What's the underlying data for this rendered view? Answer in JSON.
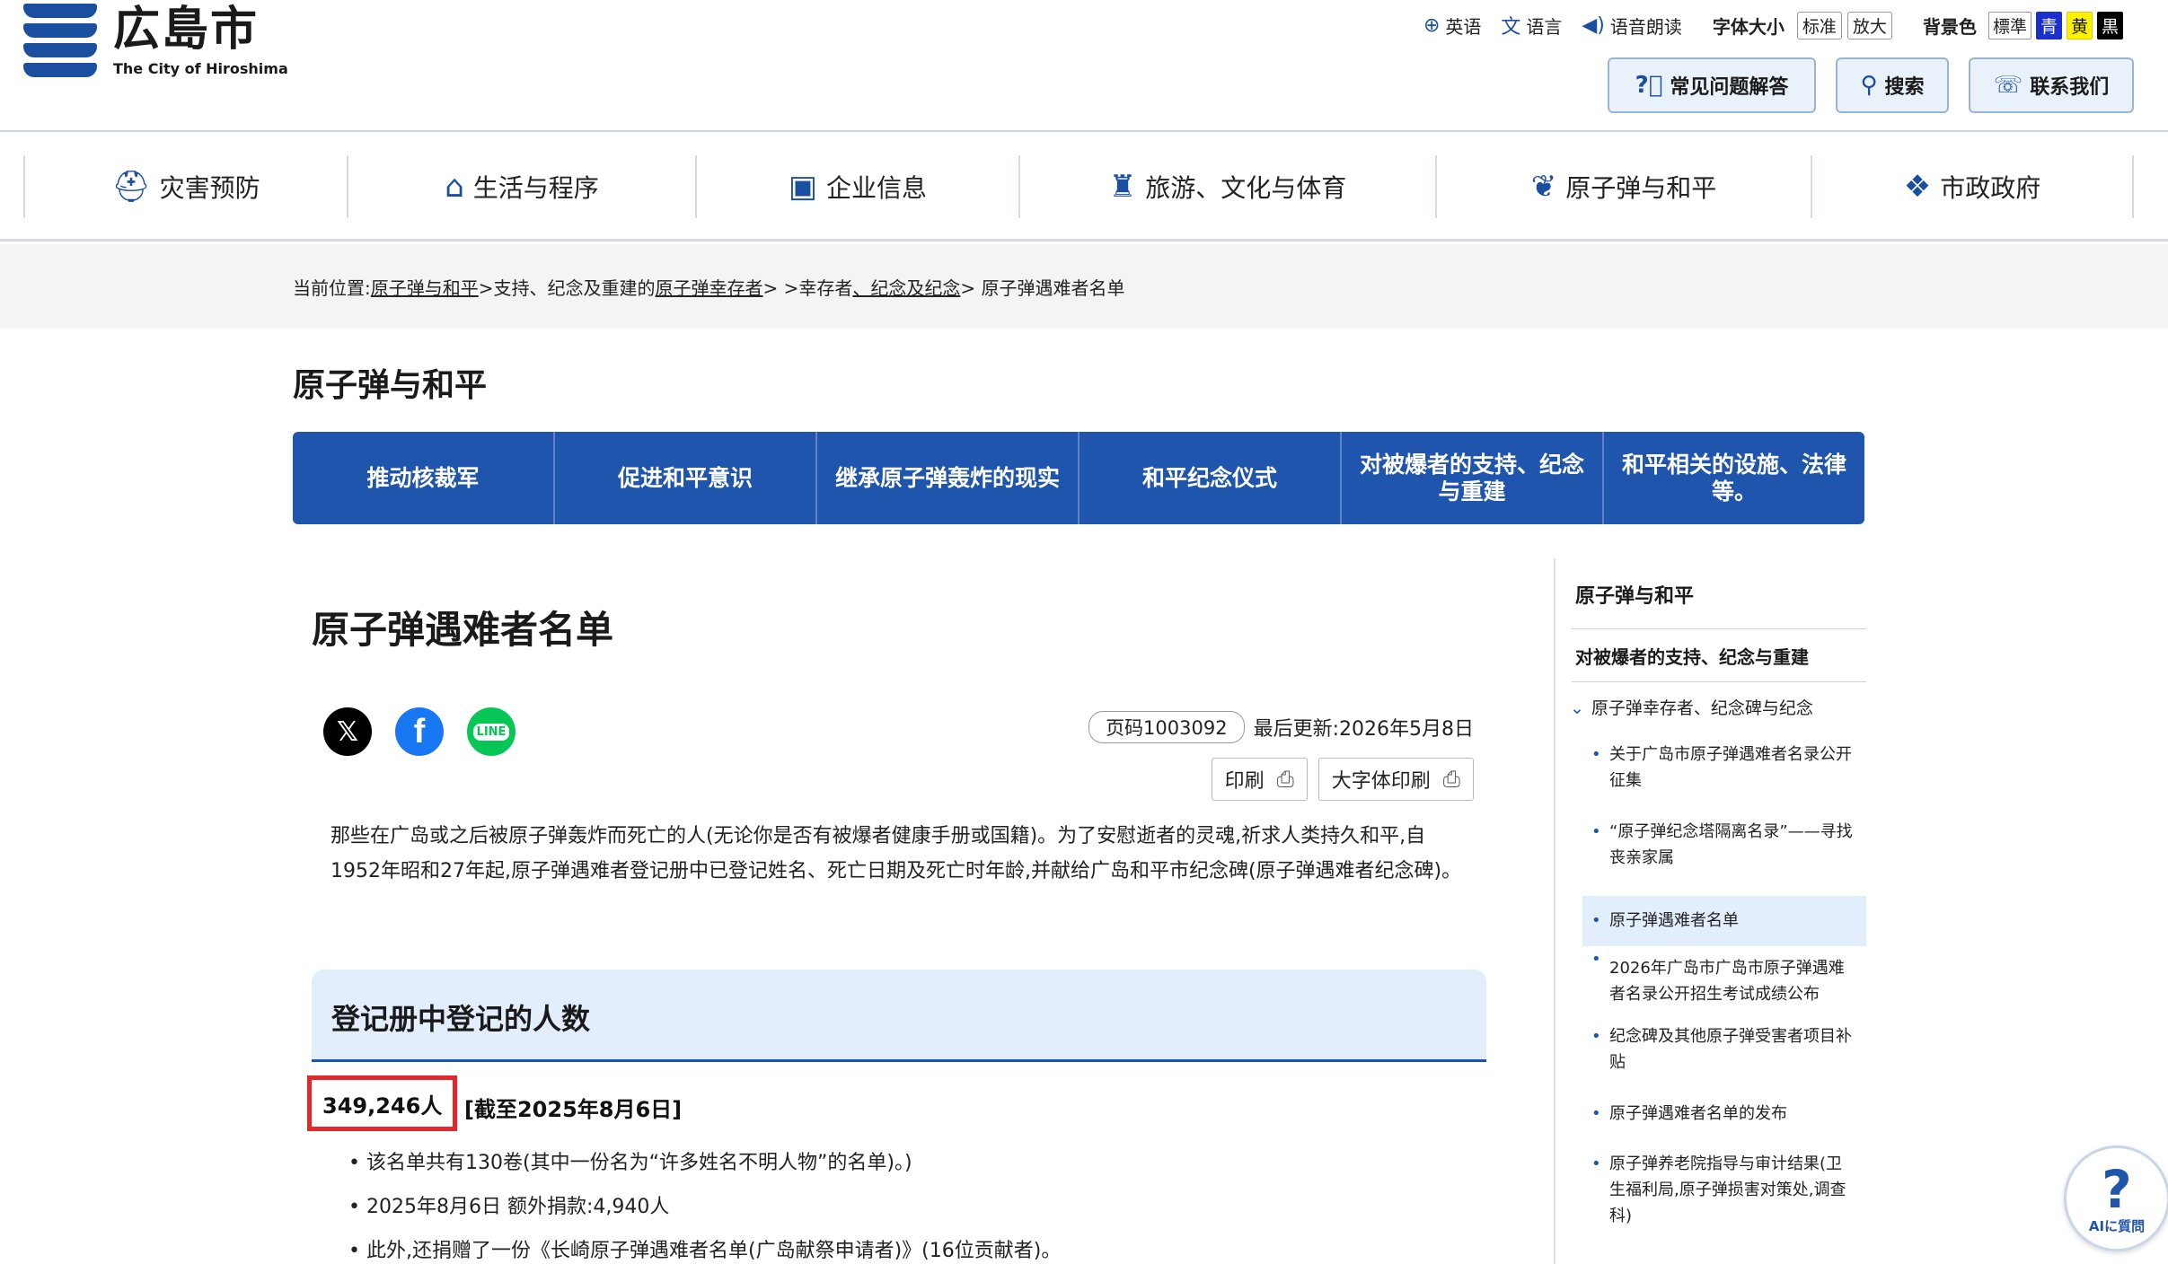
{
  "header": {
    "logo_jp": "広島市",
    "logo_en": "The City of Hiroshima",
    "util": {
      "english": "英语",
      "language": "语言",
      "read_aloud": "语音朗读",
      "font_size_label": "字体大小",
      "font_standard": "标准",
      "font_large": "放大",
      "bg_label": "背景色",
      "bg_standard": "標準",
      "bg_blue": "青",
      "bg_yellow": "黄",
      "bg_black": "黒"
    },
    "buttons": {
      "faq": "常见问题解答",
      "search": "搜索",
      "contact": "联系我们"
    }
  },
  "global_nav": [
    {
      "label": "灾害预防",
      "icon": "helmet-icon"
    },
    {
      "label": "生活与程序",
      "icon": "house-icon"
    },
    {
      "label": "企业信息",
      "icon": "briefcase-icon"
    },
    {
      "label": "旅游、文化与体育",
      "icon": "castle-icon"
    },
    {
      "label": "原子弹与和平",
      "icon": "dove-icon"
    },
    {
      "label": "市政政府",
      "icon": "handshake-icon"
    }
  ],
  "breadcrumb": {
    "prefix": "当前位置:",
    "c1": "原子弹与和平",
    "sep1": ">支持、纪念及重建的",
    "c2": "原子弹幸存者",
    "sep2": "> >幸存者",
    "c3": "、纪念及纪念",
    "sep3": "> 原子弹遇难者名单"
  },
  "section_title": "原子弹与和平",
  "sub_nav": [
    "推动核裁军",
    "促进和平意识",
    "继承原子弹轰炸的现实",
    "和平纪念仪式",
    "对被爆者的支持、纪念与重建",
    "和平相关的设施、法律等。"
  ],
  "main": {
    "title": "原子弹遇难者名单",
    "page_no": "页码1003092",
    "last_updated": "最后更新:2026年5月8日",
    "print": "印刷",
    "print_large": "大字体印刷",
    "lead": "那些在广岛或之后被原子弹轰炸而死亡的人(无论你是否有被爆者健康手册或国籍)。为了安慰逝者的灵魂,祈求人类持久和平,自1952年昭和27年起,原子弹遇难者登记册中已登记姓名、死亡日期及死亡时年龄,并献给广岛和平市纪念碑(原子弹遇难者纪念碑)。",
    "h2": "登记册中登记的人数",
    "count": "349,246人",
    "count_date": "[截至2025年8月6日]",
    "bullets": [
      "该名单共有130卷(其中一份名为“许多姓名不明人物”的名单)。)",
      "2025年8月6日 额外捐款:4,940人",
      "此外,还捐赠了一份《长崎原子弹遇难者名单(广岛献祭申请者)》(16位贡献者)。"
    ]
  },
  "sidebar": {
    "head": "原子弹与和平",
    "sub": "对被爆者的支持、纪念与重建",
    "sub2": "原子弹幸存者、纪念碑与纪念",
    "items": [
      "关于广岛市原子弹遇难者名录公开征集",
      "“原子弹纪念塔隔离名录”——寻找丧亲家属",
      "原子弹遇难者名单",
      "2026年广岛市广岛市原子弹遇难者名录公开招生考试成绩公布",
      "纪念碑及其他原子弹受害者项目补贴",
      "原子弹遇难者名单的发布",
      "原子弹养老院指导与审计结果(卫生福利局,原子弹损害对策处,调查科)"
    ]
  },
  "ai_help": "AIに質問"
}
